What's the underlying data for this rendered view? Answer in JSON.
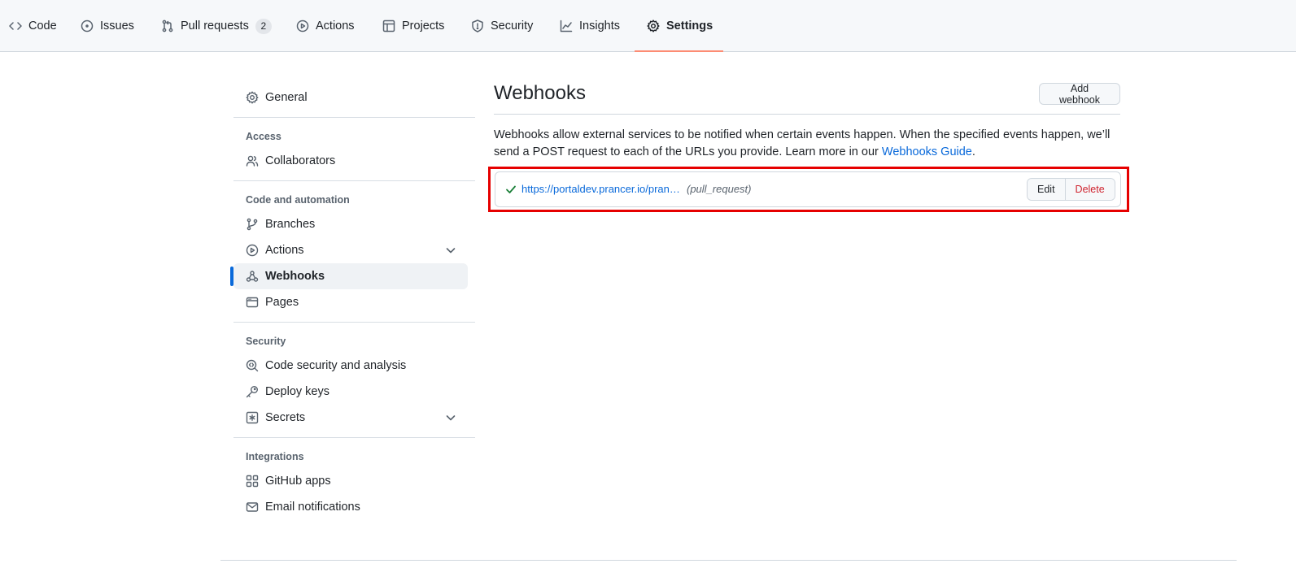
{
  "repo_nav": {
    "tabs": [
      {
        "label": "Code",
        "icon": "code-icon"
      },
      {
        "label": "Issues",
        "icon": "issue-opened-icon"
      },
      {
        "label": "Pull requests",
        "icon": "git-pull-request-icon",
        "count": "2"
      },
      {
        "label": "Actions",
        "icon": "play-icon"
      },
      {
        "label": "Projects",
        "icon": "table-icon"
      },
      {
        "label": "Security",
        "icon": "shield-icon"
      },
      {
        "label": "Insights",
        "icon": "graph-icon"
      },
      {
        "label": "Settings",
        "icon": "gear-icon",
        "selected": true
      }
    ],
    "selected_underline_color": "#fd8c73"
  },
  "sidebar": {
    "general": "General",
    "access_heading": "Access",
    "collaborators": "Collaborators",
    "code_automation_heading": "Code and automation",
    "branches": "Branches",
    "actions": "Actions",
    "webhooks": "Webhooks",
    "pages": "Pages",
    "security_heading": "Security",
    "code_security": "Code security and analysis",
    "deploy_keys": "Deploy keys",
    "secrets": "Secrets",
    "integrations_heading": "Integrations",
    "github_apps": "GitHub apps",
    "email_notifications": "Email notifications",
    "active_item": "Webhooks",
    "active_accent_color": "#0969da"
  },
  "main": {
    "title": "Webhooks",
    "add_button": "Add webhook",
    "description_text": "Webhooks allow external services to be notified when certain events happen. When the specified events happen, we’ll send a POST request to each of the URLs you provide. Learn more in our ",
    "description_link": "Webhooks Guide",
    "description_end": ".",
    "webhooks": [
      {
        "url": "https://portaldev.prancer.io/pran…",
        "event": "(pull_request)",
        "status": "check-icon",
        "edit_label": "Edit",
        "delete_label": "Delete"
      }
    ],
    "highlight_color": "#e60000"
  }
}
